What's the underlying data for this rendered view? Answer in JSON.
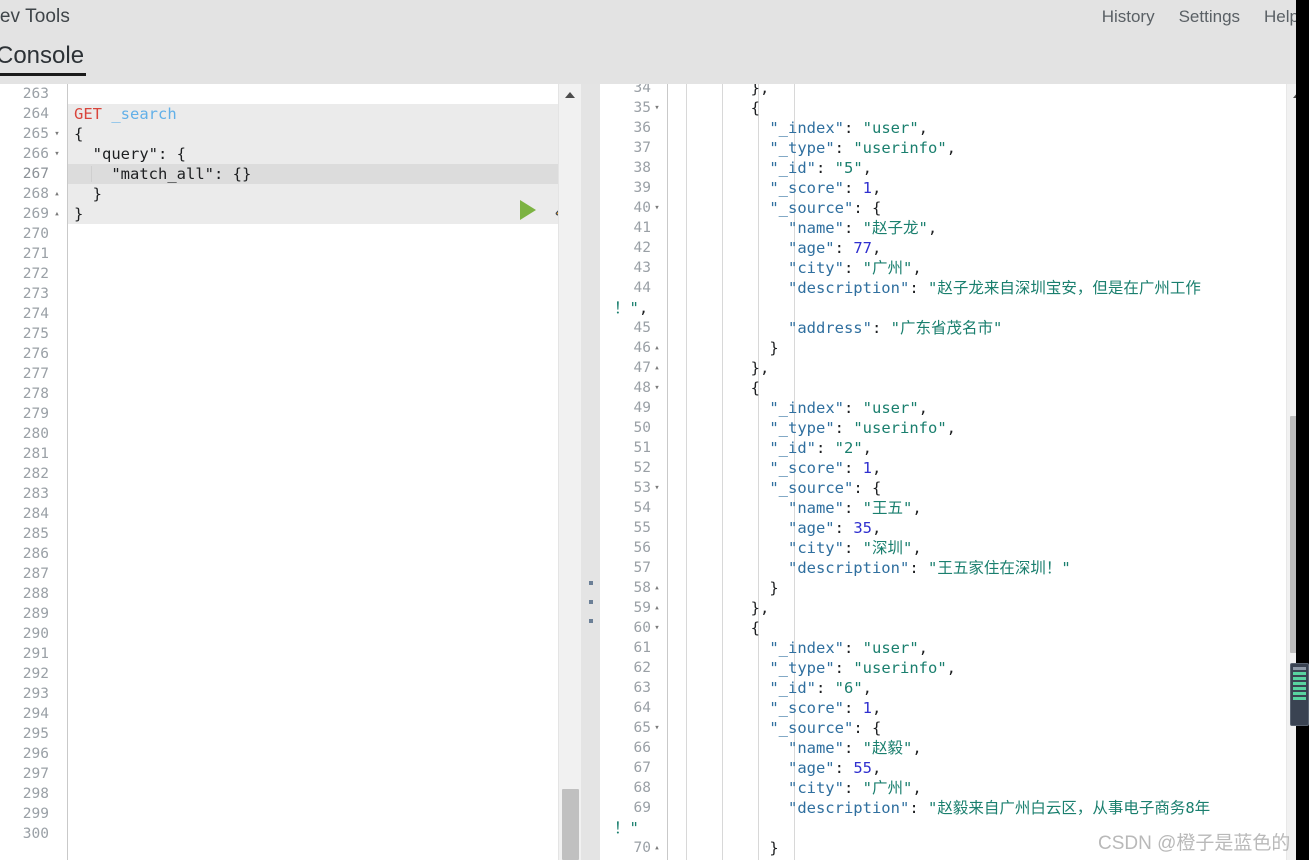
{
  "header": {
    "app_title": "Dev Tools",
    "nav": [
      {
        "label": "History",
        "name": "history"
      },
      {
        "label": "Settings",
        "name": "settings"
      },
      {
        "label": "Help",
        "name": "help"
      }
    ],
    "tabs": [
      {
        "label": "Console",
        "active": true
      }
    ]
  },
  "editor": {
    "first_line_number": 263,
    "last_line_number": 300,
    "active_line_number": 267,
    "run_icon": "play-icon",
    "wrench_icon": "wrench-icon",
    "request": {
      "method": "GET",
      "path": "_search",
      "body_lines": [
        "{",
        "  \"query\": {",
        "    \"match_all\": {}",
        "  }",
        "}"
      ]
    },
    "lines": [
      {
        "n": 263,
        "fold": "",
        "text": ""
      },
      {
        "n": 264,
        "fold": "",
        "text": "GET _search",
        "kind": "request"
      },
      {
        "n": 265,
        "fold": "down",
        "text": "{"
      },
      {
        "n": 266,
        "fold": "down",
        "text": "  \"query\": {"
      },
      {
        "n": 267,
        "fold": "",
        "text": "    \"match_all\": {}",
        "active": true
      },
      {
        "n": 268,
        "fold": "up",
        "text": "  }"
      },
      {
        "n": 269,
        "fold": "up",
        "text": "}"
      },
      {
        "n": 270,
        "fold": "",
        "text": ""
      },
      {
        "n": 271,
        "fold": "",
        "text": ""
      },
      {
        "n": 272,
        "fold": "",
        "text": ""
      },
      {
        "n": 273,
        "fold": "",
        "text": ""
      },
      {
        "n": 274,
        "fold": "",
        "text": ""
      },
      {
        "n": 275,
        "fold": "",
        "text": ""
      },
      {
        "n": 276,
        "fold": "",
        "text": ""
      },
      {
        "n": 277,
        "fold": "",
        "text": ""
      },
      {
        "n": 278,
        "fold": "",
        "text": ""
      },
      {
        "n": 279,
        "fold": "",
        "text": ""
      },
      {
        "n": 280,
        "fold": "",
        "text": ""
      },
      {
        "n": 281,
        "fold": "",
        "text": ""
      },
      {
        "n": 282,
        "fold": "",
        "text": ""
      },
      {
        "n": 283,
        "fold": "",
        "text": ""
      },
      {
        "n": 284,
        "fold": "",
        "text": ""
      },
      {
        "n": 285,
        "fold": "",
        "text": ""
      },
      {
        "n": 286,
        "fold": "",
        "text": ""
      },
      {
        "n": 287,
        "fold": "",
        "text": ""
      },
      {
        "n": 288,
        "fold": "",
        "text": ""
      },
      {
        "n": 289,
        "fold": "",
        "text": ""
      },
      {
        "n": 290,
        "fold": "",
        "text": ""
      },
      {
        "n": 291,
        "fold": "",
        "text": ""
      },
      {
        "n": 292,
        "fold": "",
        "text": ""
      },
      {
        "n": 293,
        "fold": "",
        "text": ""
      },
      {
        "n": 294,
        "fold": "",
        "text": ""
      },
      {
        "n": 295,
        "fold": "",
        "text": ""
      },
      {
        "n": 296,
        "fold": "",
        "text": ""
      },
      {
        "n": 297,
        "fold": "",
        "text": ""
      },
      {
        "n": 298,
        "fold": "",
        "text": ""
      },
      {
        "n": 299,
        "fold": "",
        "text": ""
      },
      {
        "n": 300,
        "fold": "",
        "text": ""
      }
    ]
  },
  "output": {
    "first_line_number": 34,
    "last_line_number": 70,
    "lines": [
      {
        "n": 34,
        "fold": "",
        "segments": [
          {
            "t": "        },",
            "c": "p"
          }
        ]
      },
      {
        "n": 35,
        "fold": "down",
        "segments": [
          {
            "t": "        {",
            "c": "p"
          }
        ]
      },
      {
        "n": 36,
        "fold": "",
        "segments": [
          {
            "t": "          ",
            "c": "p"
          },
          {
            "t": "\"_index\"",
            "c": "k"
          },
          {
            "t": ": ",
            "c": "p"
          },
          {
            "t": "\"user\"",
            "c": "s"
          },
          {
            "t": ",",
            "c": "p"
          }
        ]
      },
      {
        "n": 37,
        "fold": "",
        "segments": [
          {
            "t": "          ",
            "c": "p"
          },
          {
            "t": "\"_type\"",
            "c": "k"
          },
          {
            "t": ": ",
            "c": "p"
          },
          {
            "t": "\"userinfo\"",
            "c": "s"
          },
          {
            "t": ",",
            "c": "p"
          }
        ]
      },
      {
        "n": 38,
        "fold": "",
        "segments": [
          {
            "t": "          ",
            "c": "p"
          },
          {
            "t": "\"_id\"",
            "c": "k"
          },
          {
            "t": ": ",
            "c": "p"
          },
          {
            "t": "\"5\"",
            "c": "s"
          },
          {
            "t": ",",
            "c": "p"
          }
        ]
      },
      {
        "n": 39,
        "fold": "",
        "segments": [
          {
            "t": "          ",
            "c": "p"
          },
          {
            "t": "\"_score\"",
            "c": "k"
          },
          {
            "t": ": ",
            "c": "p"
          },
          {
            "t": "1",
            "c": "n"
          },
          {
            "t": ",",
            "c": "p"
          }
        ]
      },
      {
        "n": 40,
        "fold": "down",
        "segments": [
          {
            "t": "          ",
            "c": "p"
          },
          {
            "t": "\"_source\"",
            "c": "k"
          },
          {
            "t": ": {",
            "c": "p"
          }
        ]
      },
      {
        "n": 41,
        "fold": "",
        "segments": [
          {
            "t": "            ",
            "c": "p"
          },
          {
            "t": "\"name\"",
            "c": "k"
          },
          {
            "t": ": ",
            "c": "p"
          },
          {
            "t": "\"赵子龙\"",
            "c": "s"
          },
          {
            "t": ",",
            "c": "p"
          }
        ]
      },
      {
        "n": 42,
        "fold": "",
        "segments": [
          {
            "t": "            ",
            "c": "p"
          },
          {
            "t": "\"age\"",
            "c": "k"
          },
          {
            "t": ": ",
            "c": "p"
          },
          {
            "t": "77",
            "c": "n"
          },
          {
            "t": ",",
            "c": "p"
          }
        ]
      },
      {
        "n": 43,
        "fold": "",
        "segments": [
          {
            "t": "            ",
            "c": "p"
          },
          {
            "t": "\"city\"",
            "c": "k"
          },
          {
            "t": ": ",
            "c": "p"
          },
          {
            "t": "\"广州\"",
            "c": "s"
          },
          {
            "t": ",",
            "c": "p"
          }
        ]
      },
      {
        "n": 44,
        "fold": "",
        "segments": [
          {
            "t": "            ",
            "c": "p"
          },
          {
            "t": "\"description\"",
            "c": "k"
          },
          {
            "t": ": ",
            "c": "p"
          },
          {
            "t": "\"赵子龙来自深圳宝安，但是在广州工作",
            "c": "s"
          }
        ]
      },
      {
        "n": "",
        "fold": "",
        "wrap": true,
        "segments": [
          {
            "t": "！\"",
            "c": "s"
          },
          {
            "t": ",",
            "c": "p"
          }
        ]
      },
      {
        "n": 45,
        "fold": "",
        "segments": [
          {
            "t": "            ",
            "c": "p"
          },
          {
            "t": "\"address\"",
            "c": "k"
          },
          {
            "t": ": ",
            "c": "p"
          },
          {
            "t": "\"广东省茂名市\"",
            "c": "s"
          }
        ]
      },
      {
        "n": 46,
        "fold": "up",
        "segments": [
          {
            "t": "          }",
            "c": "p"
          }
        ]
      },
      {
        "n": 47,
        "fold": "up",
        "segments": [
          {
            "t": "        },",
            "c": "p"
          }
        ]
      },
      {
        "n": 48,
        "fold": "down",
        "segments": [
          {
            "t": "        {",
            "c": "p"
          }
        ]
      },
      {
        "n": 49,
        "fold": "",
        "segments": [
          {
            "t": "          ",
            "c": "p"
          },
          {
            "t": "\"_index\"",
            "c": "k"
          },
          {
            "t": ": ",
            "c": "p"
          },
          {
            "t": "\"user\"",
            "c": "s"
          },
          {
            "t": ",",
            "c": "p"
          }
        ]
      },
      {
        "n": 50,
        "fold": "",
        "segments": [
          {
            "t": "          ",
            "c": "p"
          },
          {
            "t": "\"_type\"",
            "c": "k"
          },
          {
            "t": ": ",
            "c": "p"
          },
          {
            "t": "\"userinfo\"",
            "c": "s"
          },
          {
            "t": ",",
            "c": "p"
          }
        ]
      },
      {
        "n": 51,
        "fold": "",
        "segments": [
          {
            "t": "          ",
            "c": "p"
          },
          {
            "t": "\"_id\"",
            "c": "k"
          },
          {
            "t": ": ",
            "c": "p"
          },
          {
            "t": "\"2\"",
            "c": "s"
          },
          {
            "t": ",",
            "c": "p"
          }
        ]
      },
      {
        "n": 52,
        "fold": "",
        "segments": [
          {
            "t": "          ",
            "c": "p"
          },
          {
            "t": "\"_score\"",
            "c": "k"
          },
          {
            "t": ": ",
            "c": "p"
          },
          {
            "t": "1",
            "c": "n"
          },
          {
            "t": ",",
            "c": "p"
          }
        ]
      },
      {
        "n": 53,
        "fold": "down",
        "segments": [
          {
            "t": "          ",
            "c": "p"
          },
          {
            "t": "\"_source\"",
            "c": "k"
          },
          {
            "t": ": {",
            "c": "p"
          }
        ]
      },
      {
        "n": 54,
        "fold": "",
        "segments": [
          {
            "t": "            ",
            "c": "p"
          },
          {
            "t": "\"name\"",
            "c": "k"
          },
          {
            "t": ": ",
            "c": "p"
          },
          {
            "t": "\"王五\"",
            "c": "s"
          },
          {
            "t": ",",
            "c": "p"
          }
        ]
      },
      {
        "n": 55,
        "fold": "",
        "segments": [
          {
            "t": "            ",
            "c": "p"
          },
          {
            "t": "\"age\"",
            "c": "k"
          },
          {
            "t": ": ",
            "c": "p"
          },
          {
            "t": "35",
            "c": "n"
          },
          {
            "t": ",",
            "c": "p"
          }
        ]
      },
      {
        "n": 56,
        "fold": "",
        "segments": [
          {
            "t": "            ",
            "c": "p"
          },
          {
            "t": "\"city\"",
            "c": "k"
          },
          {
            "t": ": ",
            "c": "p"
          },
          {
            "t": "\"深圳\"",
            "c": "s"
          },
          {
            "t": ",",
            "c": "p"
          }
        ]
      },
      {
        "n": 57,
        "fold": "",
        "segments": [
          {
            "t": "            ",
            "c": "p"
          },
          {
            "t": "\"description\"",
            "c": "k"
          },
          {
            "t": ": ",
            "c": "p"
          },
          {
            "t": "\"王五家住在深圳！\"",
            "c": "s"
          }
        ]
      },
      {
        "n": 58,
        "fold": "up",
        "segments": [
          {
            "t": "          }",
            "c": "p"
          }
        ]
      },
      {
        "n": 59,
        "fold": "up",
        "segments": [
          {
            "t": "        },",
            "c": "p"
          }
        ]
      },
      {
        "n": 60,
        "fold": "down",
        "segments": [
          {
            "t": "        {",
            "c": "p"
          }
        ]
      },
      {
        "n": 61,
        "fold": "",
        "segments": [
          {
            "t": "          ",
            "c": "p"
          },
          {
            "t": "\"_index\"",
            "c": "k"
          },
          {
            "t": ": ",
            "c": "p"
          },
          {
            "t": "\"user\"",
            "c": "s"
          },
          {
            "t": ",",
            "c": "p"
          }
        ]
      },
      {
        "n": 62,
        "fold": "",
        "segments": [
          {
            "t": "          ",
            "c": "p"
          },
          {
            "t": "\"_type\"",
            "c": "k"
          },
          {
            "t": ": ",
            "c": "p"
          },
          {
            "t": "\"userinfo\"",
            "c": "s"
          },
          {
            "t": ",",
            "c": "p"
          }
        ]
      },
      {
        "n": 63,
        "fold": "",
        "segments": [
          {
            "t": "          ",
            "c": "p"
          },
          {
            "t": "\"_id\"",
            "c": "k"
          },
          {
            "t": ": ",
            "c": "p"
          },
          {
            "t": "\"6\"",
            "c": "s"
          },
          {
            "t": ",",
            "c": "p"
          }
        ]
      },
      {
        "n": 64,
        "fold": "",
        "segments": [
          {
            "t": "          ",
            "c": "p"
          },
          {
            "t": "\"_score\"",
            "c": "k"
          },
          {
            "t": ": ",
            "c": "p"
          },
          {
            "t": "1",
            "c": "n"
          },
          {
            "t": ",",
            "c": "p"
          }
        ]
      },
      {
        "n": 65,
        "fold": "down",
        "segments": [
          {
            "t": "          ",
            "c": "p"
          },
          {
            "t": "\"_source\"",
            "c": "k"
          },
          {
            "t": ": {",
            "c": "p"
          }
        ]
      },
      {
        "n": 66,
        "fold": "",
        "segments": [
          {
            "t": "            ",
            "c": "p"
          },
          {
            "t": "\"name\"",
            "c": "k"
          },
          {
            "t": ": ",
            "c": "p"
          },
          {
            "t": "\"赵毅\"",
            "c": "s"
          },
          {
            "t": ",",
            "c": "p"
          }
        ]
      },
      {
        "n": 67,
        "fold": "",
        "segments": [
          {
            "t": "            ",
            "c": "p"
          },
          {
            "t": "\"age\"",
            "c": "k"
          },
          {
            "t": ": ",
            "c": "p"
          },
          {
            "t": "55",
            "c": "n"
          },
          {
            "t": ",",
            "c": "p"
          }
        ]
      },
      {
        "n": 68,
        "fold": "",
        "segments": [
          {
            "t": "            ",
            "c": "p"
          },
          {
            "t": "\"city\"",
            "c": "k"
          },
          {
            "t": ": ",
            "c": "p"
          },
          {
            "t": "\"广州\"",
            "c": "s"
          },
          {
            "t": ",",
            "c": "p"
          }
        ]
      },
      {
        "n": 69,
        "fold": "",
        "segments": [
          {
            "t": "            ",
            "c": "p"
          },
          {
            "t": "\"description\"",
            "c": "k"
          },
          {
            "t": ": ",
            "c": "p"
          },
          {
            "t": "\"赵毅来自广州白云区，从事电子商务8年",
            "c": "s"
          }
        ]
      },
      {
        "n": "",
        "fold": "",
        "wrap": true,
        "segments": [
          {
            "t": "！\"",
            "c": "s"
          }
        ]
      },
      {
        "n": 70,
        "fold": "up",
        "segments": [
          {
            "t": "          }",
            "c": "p"
          }
        ]
      }
    ],
    "hits": [
      {
        "_index": "user",
        "_type": "userinfo",
        "_id": "5",
        "_score": 1,
        "_source": {
          "name": "赵子龙",
          "age": 77,
          "city": "广州",
          "description": "赵子龙来自深圳宝安，但是在广州工作！",
          "address": "广东省茂名市"
        }
      },
      {
        "_index": "user",
        "_type": "userinfo",
        "_id": "2",
        "_score": 1,
        "_source": {
          "name": "王五",
          "age": 35,
          "city": "深圳",
          "description": "王五家住在深圳！"
        }
      },
      {
        "_index": "user",
        "_type": "userinfo",
        "_id": "6",
        "_score": 1,
        "_source": {
          "name": "赵毅",
          "age": 55,
          "city": "广州",
          "description": "赵毅来自广州白云区，从事电子商务8年！"
        }
      }
    ]
  },
  "watermark": {
    "text": "CSDN @橙子是蓝色的"
  },
  "colors": {
    "header_bg": "#e3e3e3",
    "keyword": "#d9453c",
    "path": "#62b0e8",
    "json_key": "#2f6f9f",
    "json_string": "#1a7f6e",
    "json_number": "#3030cf",
    "run_green": "#7cb342",
    "active_line": "#dcdcdc"
  }
}
